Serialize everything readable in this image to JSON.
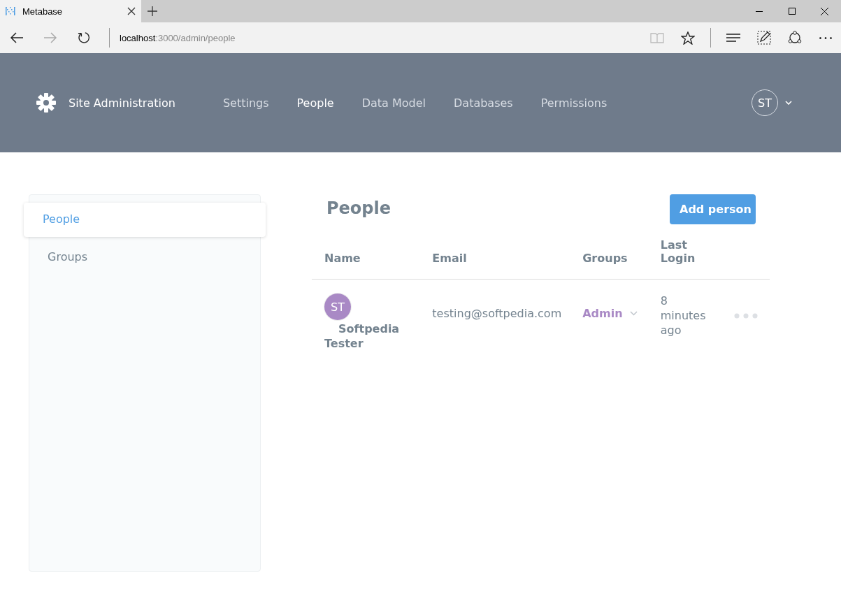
{
  "browser": {
    "tab_title": "Metabase",
    "url_host": "localhost",
    "url_path": ":3000/admin/people"
  },
  "header": {
    "title": "Site Administration",
    "nav": [
      {
        "label": "Settings",
        "selected": false
      },
      {
        "label": "People",
        "selected": true
      },
      {
        "label": "Data Model",
        "selected": false
      },
      {
        "label": "Databases",
        "selected": false
      },
      {
        "label": "Permissions",
        "selected": false
      }
    ],
    "avatar": "ST"
  },
  "sidebar": {
    "items": [
      {
        "label": "People",
        "selected": true
      },
      {
        "label": "Groups",
        "selected": false
      }
    ]
  },
  "people": {
    "title": "People",
    "add_button": "Add person",
    "columns": [
      "Name",
      "Email",
      "Groups",
      "Last Login"
    ],
    "rows": [
      {
        "initials": "ST",
        "name": "Softpedia Tester",
        "email": "testing@softpedia.com",
        "group": "Admin",
        "last_login": "8 minutes ago"
      }
    ]
  }
}
